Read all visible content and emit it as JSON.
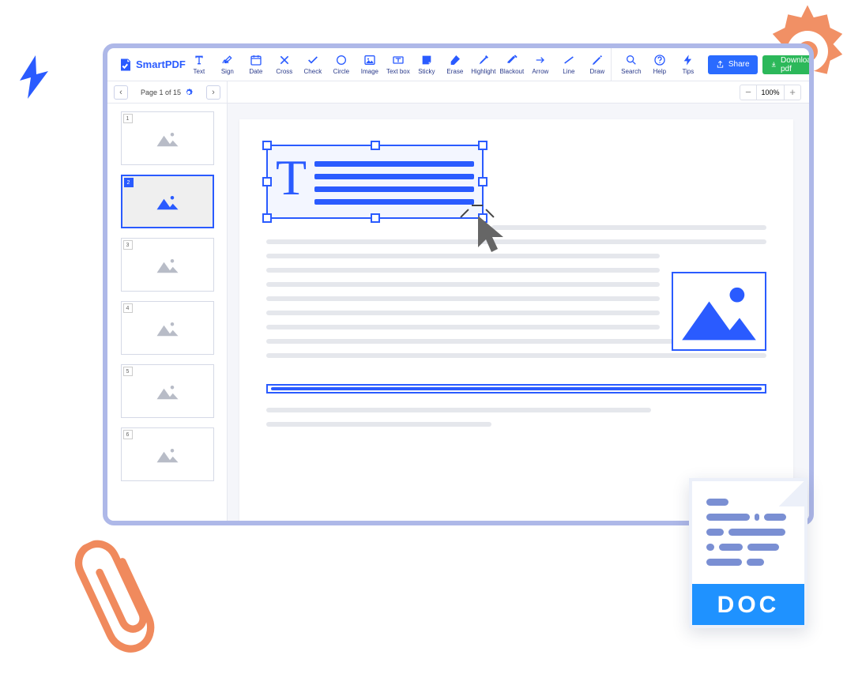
{
  "brand": "SmartPDF",
  "tools": [
    "Text",
    "Sign",
    "Date",
    "Cross",
    "Check",
    "Circle",
    "Image",
    "Text box",
    "Sticky",
    "Erase",
    "Highlight",
    "Blackout",
    "Arrow",
    "Line",
    "Draw"
  ],
  "help_tools": [
    "Search",
    "Help",
    "Tips"
  ],
  "actions": {
    "share": "Share",
    "download": "Download pdf"
  },
  "page_label": "Page 1 of 15",
  "zoom": "100%",
  "thumbs": [
    "1",
    "2",
    "3",
    "4",
    "5",
    "6"
  ],
  "active_thumb": 1,
  "doc_label": "DOC"
}
